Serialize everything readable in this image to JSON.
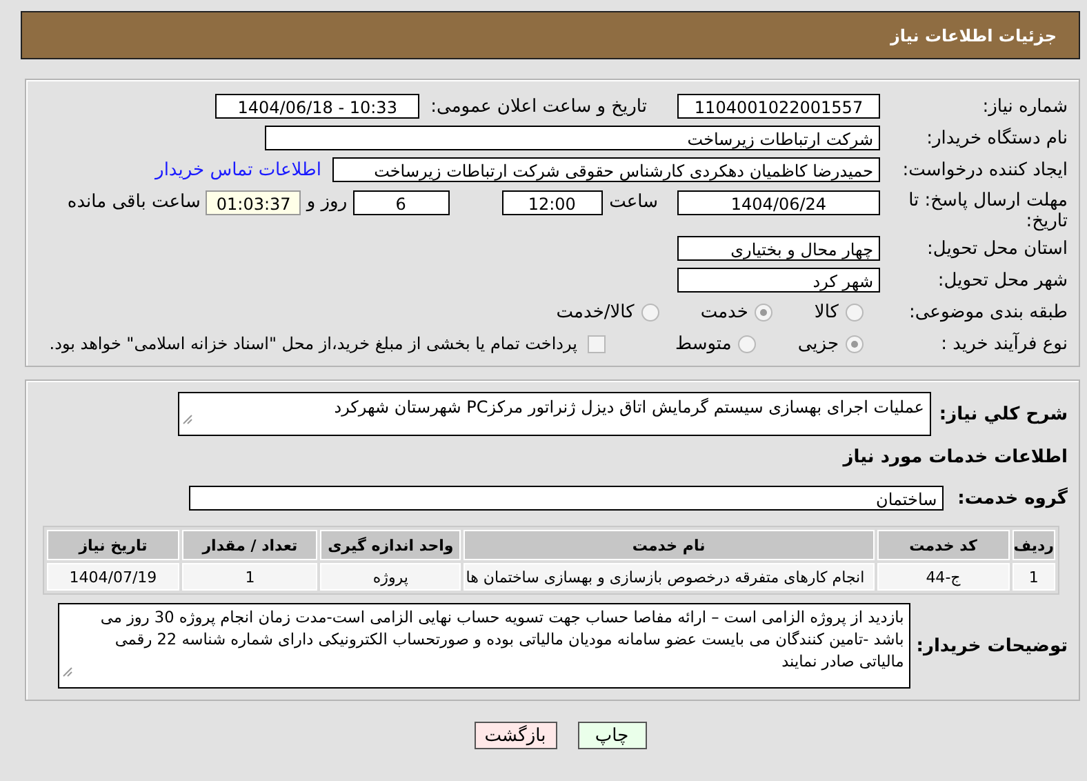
{
  "header": {
    "title": "جزئیات اطلاعات نیاز"
  },
  "details": {
    "need_number": {
      "label": "شماره نیاز:",
      "value": "1104001022001557"
    },
    "announce": {
      "label": "تاریخ و ساعت اعلان عمومی:",
      "value": "1404/06/18 - 10:33"
    },
    "buyer": {
      "label": "نام دستگاه خریدار:",
      "value": "شرکت ارتباطات زیرساخت"
    },
    "creator": {
      "label": "ایجاد کننده درخواست:",
      "value": "حمیدرضا کاظمیان دهکردی کارشناس حقوقی شرکت ارتباطات زیرساخت",
      "link": "اطلاعات تماس خریدار"
    },
    "deadline": {
      "label": "مهلت ارسال پاسخ: تا تاریخ:",
      "date": "1404/06/24",
      "time_label": "ساعت",
      "time": "12:00",
      "days": "6",
      "days_label": "روز و",
      "remaining": "01:03:37",
      "remaining_label": "ساعت باقی مانده"
    },
    "province": {
      "label": "استان محل تحویل:",
      "value": "چهار محال و بختیاری"
    },
    "city": {
      "label": "شهر محل تحویل:",
      "value": "شهر کرد"
    },
    "category": {
      "label": "طبقه بندی موضوعی:",
      "options": [
        {
          "label": "کالا",
          "selected": false
        },
        {
          "label": "خدمت",
          "selected": true
        },
        {
          "label": "کالا/خدمت",
          "selected": false
        }
      ]
    },
    "process": {
      "label": "نوع فرآیند خرید :",
      "options": [
        {
          "label": "جزیی",
          "selected": true
        },
        {
          "label": "متوسط",
          "selected": false
        }
      ],
      "payment": {
        "label": "پرداخت تمام یا بخشی از مبلغ خرید،از محل \"اسناد خزانه اسلامی\" خواهد بود.",
        "checked": false
      }
    }
  },
  "services": {
    "summary": {
      "label": "شرح کلي نیاز:",
      "value": "عملیات اجرای بهسازی سیستم گرمایش اتاق دیزل ژنراتور مرکزPC شهرستان شهرکرد"
    },
    "heading": "اطلاعات خدمات مورد نیاز",
    "group": {
      "label": "گروه خدمت:",
      "value": "ساختمان"
    },
    "table": {
      "columns": [
        "ردیف",
        "کد خدمت",
        "نام خدمت",
        "واحد اندازه گیری",
        "تعداد / مقدار",
        "تاریخ نیاز"
      ],
      "rows": [
        [
          "1",
          "ج-44",
          "انجام کارهای متفرقه درخصوص بازسازی و بهسازی ساختمان ها",
          "پروژه",
          "1",
          "1404/07/19"
        ]
      ]
    },
    "notes": {
      "label": "توضیحات خریدار:",
      "value": "بازدید از پروژه الزامی است –  ارائه مفاصا حساب جهت تسویه حساب نهایی الزامی است-مدت زمان انجام پروژه 30 روز می باشد -تامین کنندگان می بایست عضو سامانه مودیان مالیاتی بوده و صورتحساب الکترونیکی دارای شماره شناسه 22 رقمی مالیاتی صادر نمایند"
    }
  },
  "buttons": [
    {
      "label": "چاپ",
      "kind": "print"
    },
    {
      "label": "بازگشت",
      "kind": "back"
    }
  ]
}
